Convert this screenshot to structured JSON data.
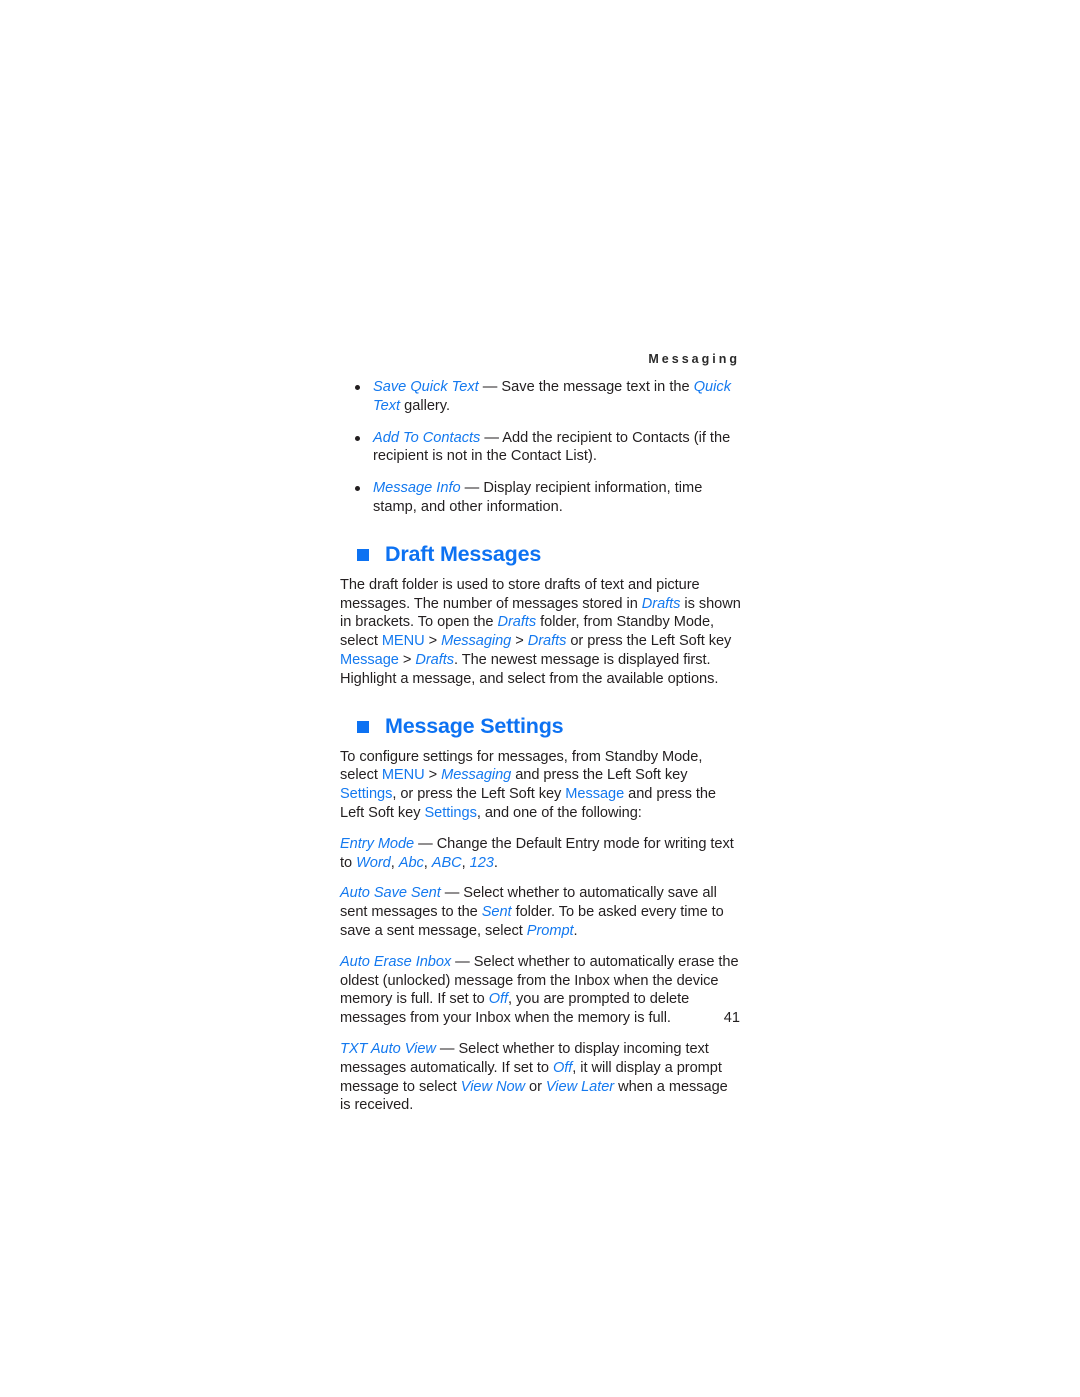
{
  "document": {
    "running_header": "Messaging",
    "page_number": "41",
    "accent_color": "#1479ef",
    "text_color": "#231f20"
  },
  "bullets": [
    {
      "term": "Save Quick Text",
      "dash": " — ",
      "text_1": "Save the message text in the ",
      "term_2": "Quick Text",
      "text_2": " gallery."
    },
    {
      "term": "Add To Contacts",
      "dash": " — ",
      "text_1": "Add the recipient to Contacts (if the recipient is not in the Contact List).",
      "term_2": "",
      "text_2": ""
    },
    {
      "term": "Message Info",
      "dash": " — ",
      "text_1": "Display recipient information, time stamp, and other information.",
      "term_2": "",
      "text_2": ""
    }
  ],
  "draft_messages": {
    "heading": "Draft Messages",
    "bullet_icon": "square-bullet",
    "body": {
      "s1": "The draft folder is used to store drafts of text and picture messages. The number of messages stored in ",
      "drafts_1": "Drafts",
      "s2": " is shown in brackets. To open the ",
      "drafts_2": "Drafts",
      "s3": " folder, from Standby Mode, select ",
      "menu": "MENU",
      "s4": " > ",
      "messaging": "Messaging",
      "s5": " > ",
      "drafts_3": "Drafts",
      "s6": " or press the Left Soft key ",
      "message_key": "Message",
      "s7": " > ",
      "drafts_4": "Drafts",
      "s8": ". The newest message is displayed first. Highlight a message, and select from the available options."
    }
  },
  "message_settings": {
    "heading": "Message Settings",
    "bullet_icon": "square-bullet",
    "intro": {
      "s1": "To configure settings for messages, from Standby Mode, select ",
      "menu": "MENU",
      "s2": " > ",
      "messaging": "Messaging",
      "s3": " and press the Left Soft key ",
      "settings_1": "Settings",
      "s4": ", or press the Left Soft key ",
      "message_key": "Message",
      "s5": " and press the Left Soft key ",
      "settings_2": "Settings",
      "s6": ", and one of the following:"
    },
    "entry_mode": {
      "term": "Entry Mode",
      "dash": " — ",
      "s1": "Change the Default Entry mode for writing text to ",
      "opt_1": "Word",
      "sep_1": ", ",
      "opt_2": "Abc",
      "sep_2": ", ",
      "opt_3": "ABC",
      "sep_3": ", ",
      "opt_4": "123",
      "s2": "."
    },
    "auto_save_sent": {
      "term": "Auto Save Sent",
      "dash": " — ",
      "s1": "Select whether to automatically save all sent messages to the ",
      "sent": "Sent",
      "s2": " folder. To be asked every time to save a sent message, select ",
      "prompt": "Prompt",
      "s3": "."
    },
    "auto_erase_inbox": {
      "term": "Auto Erase Inbox",
      "dash": " — ",
      "s1": "Select whether to automatically erase the oldest (unlocked) message from the Inbox when the device memory is full. If set to ",
      "off": "Off",
      "s2": ", you are prompted to delete messages from your Inbox when the memory is full."
    },
    "txt_auto_view": {
      "term": "TXT Auto View",
      "dash": " — ",
      "s1": "Select whether to display incoming text messages automatically. If set to ",
      "off": "Off",
      "s2": ", it will display a prompt message to select ",
      "view_now": "View Now",
      "s3": " or ",
      "view_later": "View Later",
      "s4": " when a message is received."
    }
  }
}
